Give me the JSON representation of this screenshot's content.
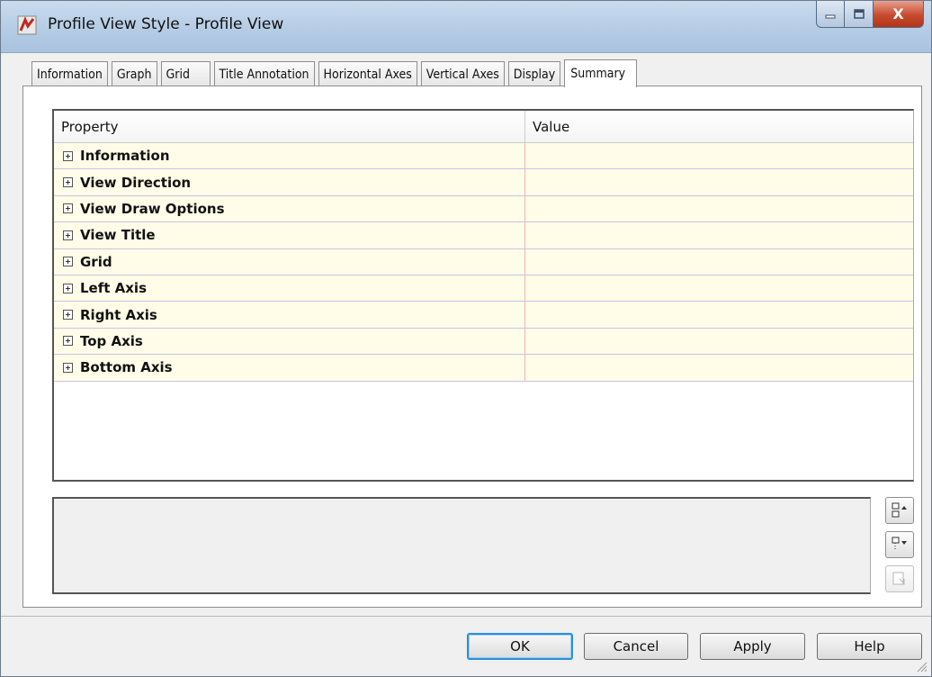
{
  "window": {
    "title": "Profile View Style - Profile View",
    "close_label": "X"
  },
  "tabs": [
    {
      "label": "Information"
    },
    {
      "label": "Graph"
    },
    {
      "label": "Grid"
    },
    {
      "label": "Title Annotation"
    },
    {
      "label": "Horizontal Axes"
    },
    {
      "label": "Vertical Axes"
    },
    {
      "label": "Display"
    },
    {
      "label": "Summary",
      "active": true
    }
  ],
  "grid": {
    "columns": {
      "property": "Property",
      "value": "Value"
    },
    "rows": [
      {
        "label": "Information",
        "value": ""
      },
      {
        "label": "View Direction",
        "value": ""
      },
      {
        "label": "View Draw Options",
        "value": ""
      },
      {
        "label": "View Title",
        "value": ""
      },
      {
        "label": "Grid",
        "value": ""
      },
      {
        "label": "Left Axis",
        "value": ""
      },
      {
        "label": "Right Axis",
        "value": ""
      },
      {
        "label": "Top Axis",
        "value": ""
      },
      {
        "label": "Bottom Axis",
        "value": ""
      }
    ]
  },
  "side_buttons": {
    "expand_icon": "expand-all-icon",
    "collapse_icon": "collapse-all-icon",
    "copy_icon": "copy-to-clipboard-icon"
  },
  "footer": {
    "ok": "OK",
    "cancel": "Cancel",
    "apply": "Apply",
    "help": "Help"
  },
  "colors": {
    "row_background": "#fffde8",
    "row_border": "#c8c2ea",
    "column_divider": "#f2b5b5",
    "close_button": "#c74a2e",
    "default_button_border": "#2b8fd8"
  }
}
